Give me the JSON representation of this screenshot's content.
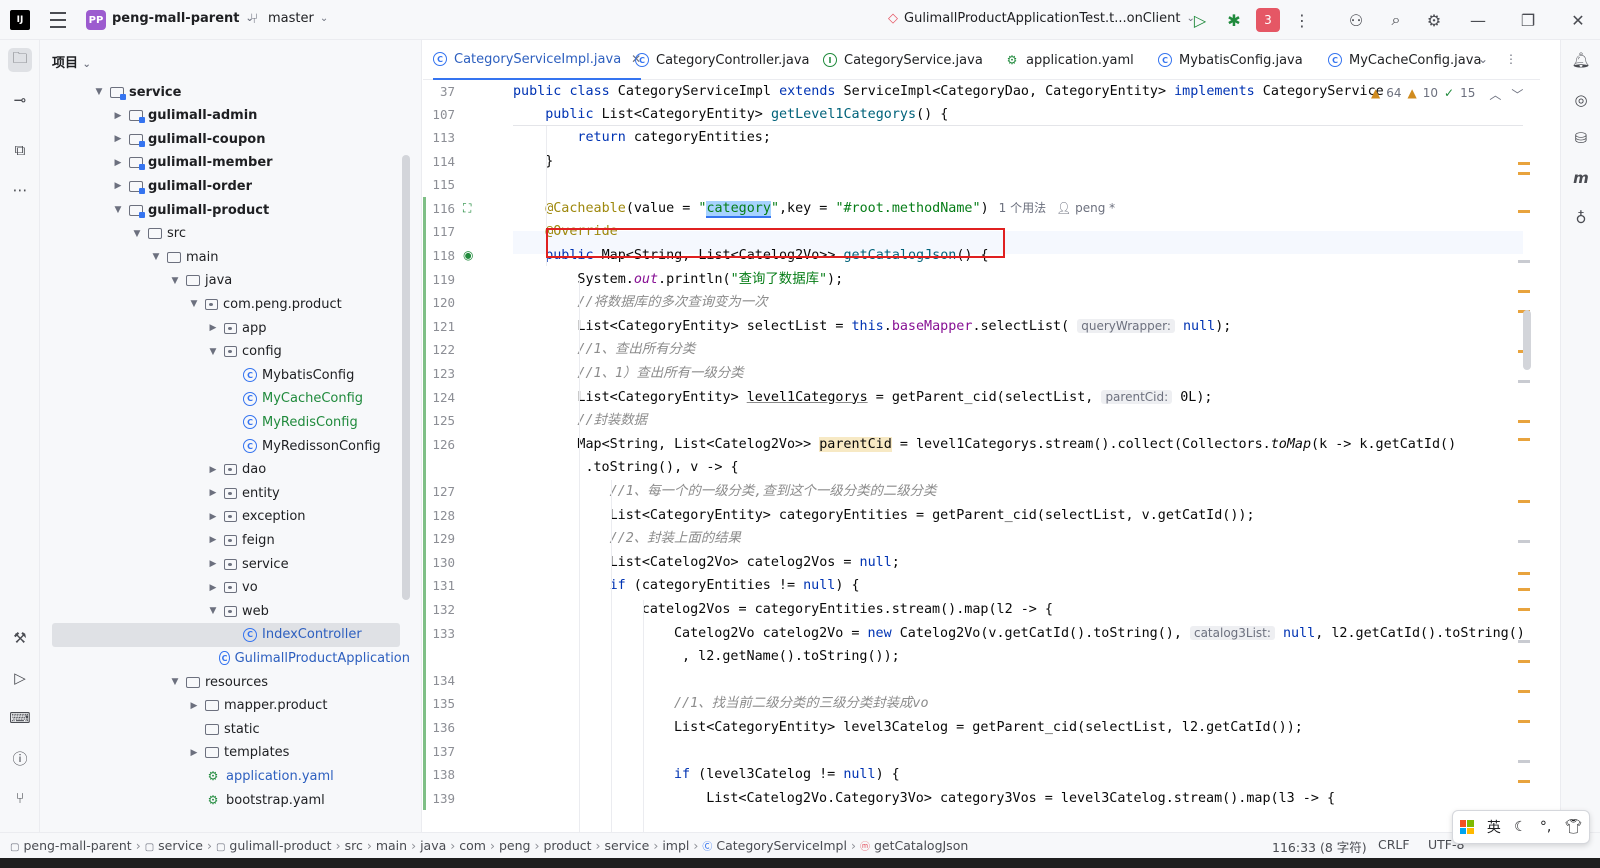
{
  "titlebar": {
    "logo": "IJ",
    "project_badge": "PP",
    "project_name": "peng-mall-parent",
    "branch": "master",
    "run_config": "GulimallProductApplicationTest.t...onClient",
    "services_count": "3"
  },
  "left_tools": [
    "folder-icon",
    "commit-icon",
    "structure-icon",
    "more-icon",
    "build-icon",
    "services-icon",
    "terminal-icon",
    "problems-icon",
    "git-icon"
  ],
  "project_panel": {
    "header": "项目",
    "tree": [
      {
        "label": "service",
        "type": "module",
        "expanded": true,
        "bold": true
      },
      {
        "label": "gulimall-admin",
        "type": "module",
        "expanded": false,
        "bold": true
      },
      {
        "label": "gulimall-coupon",
        "type": "module",
        "expanded": false,
        "bold": true
      },
      {
        "label": "gulimall-member",
        "type": "module",
        "expanded": false,
        "bold": true
      },
      {
        "label": "gulimall-order",
        "type": "module",
        "expanded": false,
        "bold": true
      },
      {
        "label": "gulimall-product",
        "type": "module",
        "expanded": true,
        "bold": true
      },
      {
        "label": "src",
        "type": "folder",
        "expanded": true
      },
      {
        "label": "main",
        "type": "folder",
        "expanded": true
      },
      {
        "label": "java",
        "type": "folder",
        "expanded": true
      },
      {
        "label": "com.peng.product",
        "type": "package",
        "expanded": true
      },
      {
        "label": "app",
        "type": "package",
        "expanded": false
      },
      {
        "label": "config",
        "type": "package",
        "expanded": true
      },
      {
        "label": "MybatisConfig",
        "type": "class",
        "color": "normal"
      },
      {
        "label": "MyCacheConfig",
        "type": "class",
        "color": "green"
      },
      {
        "label": "MyRedisConfig",
        "type": "class",
        "color": "green"
      },
      {
        "label": "MyRedissonConfig",
        "type": "class",
        "color": "normal"
      },
      {
        "label": "dao",
        "type": "package",
        "expanded": false
      },
      {
        "label": "entity",
        "type": "package",
        "expanded": false
      },
      {
        "label": "exception",
        "type": "package",
        "expanded": false
      },
      {
        "label": "feign",
        "type": "package",
        "expanded": false
      },
      {
        "label": "service",
        "type": "package",
        "expanded": false
      },
      {
        "label": "vo",
        "type": "package",
        "expanded": false
      },
      {
        "label": "web",
        "type": "package",
        "expanded": true
      },
      {
        "label": "IndexController",
        "type": "class",
        "color": "blue",
        "selected": true
      },
      {
        "label": "GulimallProductApplication",
        "type": "class",
        "color": "blue"
      },
      {
        "label": "resources",
        "type": "folder",
        "expanded": true
      },
      {
        "label": "mapper.product",
        "type": "folder",
        "expanded": false
      },
      {
        "label": "static",
        "type": "folder"
      },
      {
        "label": "templates",
        "type": "folder",
        "expanded": false
      },
      {
        "label": "application.yaml",
        "type": "yaml",
        "color": "blue"
      },
      {
        "label": "bootstrap.yaml",
        "type": "yaml",
        "color": "normal"
      }
    ]
  },
  "tabs": [
    {
      "label": "CategoryServiceImpl.java",
      "kind": "class",
      "active": true
    },
    {
      "label": "CategoryController.java",
      "kind": "class"
    },
    {
      "label": "CategoryService.java",
      "kind": "interface"
    },
    {
      "label": "application.yaml",
      "kind": "yaml"
    },
    {
      "label": "MybatisConfig.java",
      "kind": "class"
    },
    {
      "label": "MyCacheConfig.java",
      "kind": "class"
    }
  ],
  "problems": {
    "warnings": "64",
    "weak_warnings": "10",
    "ok": "15"
  },
  "code": {
    "sticky1": {
      "num": "37",
      "text": "public class CategoryServiceImpl extends ServiceImpl<CategoryDao, CategoryEntity> implements CategoryService"
    },
    "sticky2": {
      "num": "107",
      "text": "    public List<CategoryEntity> getLevel1Categorys() {"
    },
    "lines": [
      {
        "num": "113",
        "text": "        return categoryEntities;"
      },
      {
        "num": "114",
        "text": "    }"
      },
      {
        "num": "115",
        "text": ""
      },
      {
        "num": "116",
        "text": "@Cacheable(value = \"category\",key = \"#root.methodName\")",
        "meta_usages": "1 个用法",
        "meta_author": "peng *"
      },
      {
        "num": "117",
        "text": "@Override"
      },
      {
        "num": "118",
        "text": "public Map<String, List<Catelog2Vo>> getCatalogJson() {"
      },
      {
        "num": "119",
        "text": "System.out.println(\"查询了数据库\");"
      },
      {
        "num": "120",
        "text": "//将数据库的多次查询变为一次"
      },
      {
        "num": "121",
        "text": "List<CategoryEntity> selectList = this.baseMapper.selectList(",
        "hint": "queryWrapper:",
        "tail": "null);"
      },
      {
        "num": "122",
        "text": "//1、查出所有分类"
      },
      {
        "num": "123",
        "text": "//1、1）查出所有一级分类"
      },
      {
        "num": "124",
        "text": "List<CategoryEntity> level1Categorys = getParent_cid(selectList,",
        "hint": "parentCid:",
        "tail": "0L);"
      },
      {
        "num": "125",
        "text": "//封装数据"
      },
      {
        "num": "126",
        "text": "Map<String, List<Catelog2Vo>> parentCid = level1Categorys.stream().collect(Collectors.toMap(k -> k.getCatId()"
      },
      {
        "num": "",
        "text": ".toString(), v -> {"
      },
      {
        "num": "127",
        "text": "//1、每一个的一级分类,查到这个一级分类的二级分类"
      },
      {
        "num": "128",
        "text": "List<CategoryEntity> categoryEntities = getParent_cid(selectList, v.getCatId());"
      },
      {
        "num": "129",
        "text": "//2、封装上面的结果"
      },
      {
        "num": "130",
        "text": "List<Catelog2Vo> catelog2Vos = null;"
      },
      {
        "num": "131",
        "text": "if (categoryEntities != null) {"
      },
      {
        "num": "132",
        "text": "catelog2Vos = categoryEntities.stream().map(l2 -> {"
      },
      {
        "num": "133",
        "text": "Catelog2Vo catelog2Vo = new Catelog2Vo(v.getCatId().toString(),",
        "hint": "catalog3List:",
        "tail": "null, l2.getCatId().toString()"
      },
      {
        "num": "",
        "text": ", l2.getName().toString());"
      },
      {
        "num": "134",
        "text": ""
      },
      {
        "num": "135",
        "text": "//1、找当前二级分类的三级分类封装成vo"
      },
      {
        "num": "136",
        "text": "List<CategoryEntity> level3Catelog = getParent_cid(selectList, l2.getCatId());"
      },
      {
        "num": "137",
        "text": ""
      },
      {
        "num": "138",
        "text": "if (level3Catelog != null) {"
      },
      {
        "num": "139",
        "text": "List<Catelog2Vo.Category3Vo> category3Vos = level3Catelog.stream().map(l3 -> {"
      }
    ]
  },
  "right_tools": [
    "notifications-icon",
    "ai-assistant-icon",
    "database-icon",
    "maven-icon",
    "structure-icon"
  ],
  "statusbar": {
    "breadcrumbs": [
      "peng-mall-parent",
      "service",
      "gulimall-product",
      "src",
      "main",
      "java",
      "com",
      "peng",
      "product",
      "service",
      "impl",
      "CategoryServiceImpl",
      "getCatalogJson"
    ],
    "position": "116:33 (8 字符)",
    "line_ending": "CRLF",
    "encoding": "UTF-8"
  },
  "ime": {
    "lang": "英"
  },
  "colors": {
    "accent": "#3574f0",
    "keyword": "#0033b3",
    "string": "#067d17",
    "annotation": "#9e880d",
    "highlight_box": "#e02020"
  }
}
